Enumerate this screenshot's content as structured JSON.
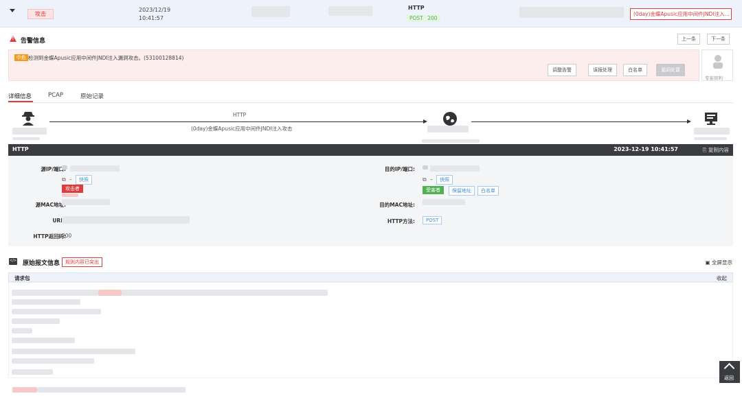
{
  "top_row": {
    "attack_label": "攻击",
    "date": "2023/12/19",
    "time": "10:41:57",
    "protocol": "HTTP",
    "method": "POST",
    "status": "200",
    "event_name": "(0day)金蝶Apusic应用中间件JNDI注入..."
  },
  "alert": {
    "title": "告警信息",
    "prev_label": "上一条",
    "next_label": "下一条",
    "level": "中危",
    "message": "检测到金蝶Apusic应用中间件JNDI注入漏洞攻击。(53100128814)",
    "actions": [
      "调整告警",
      "误报处理",
      "白名单",
      "漏洞处置"
    ],
    "expert_label": "专家研判"
  },
  "tabs": [
    "详细信息",
    "PCAP",
    "原始记录"
  ],
  "flow": {
    "protocol": "HTTP",
    "event": "(0day)金蝶Apusic应用中间件JNDI注入攻击"
  },
  "http_section": {
    "title": "HTTP",
    "timestamp": "2023-12-19 10:41:57",
    "copy_label": "复制内容",
    "src_ip_label": "源IP/端口:",
    "dst_ip_label": "目的IP/端口:",
    "src_quick_label": "快照",
    "dst_quick_label": "快照",
    "attacker_label": "攻击者",
    "victim_label": "受害者",
    "protect_label": "保留地址",
    "whitelist_label": "白名单",
    "src_mac_label": "源MAC地址:",
    "dst_mac_label": "目的MAC地址:",
    "url_label": "URL:",
    "method_label": "HTTP方法:",
    "method_value": "POST",
    "code_label": "HTTP返回码:",
    "code_value": "200"
  },
  "raw": {
    "title": "原始报文信息",
    "rule_tag": "规则内容已突出",
    "fullscreen_label": "全屏显示",
    "request_label": "请求包",
    "collapse_label": "收起"
  },
  "back_label": "返回",
  "colors": {
    "danger": "#e03b3b",
    "warning": "#f39a1a",
    "success": "#53b153",
    "dark_header": "#3a3c40",
    "link": "#3d8ee0"
  }
}
